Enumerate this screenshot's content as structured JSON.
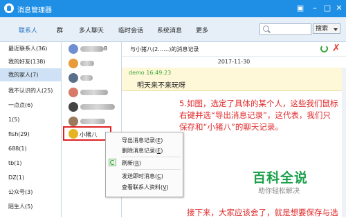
{
  "titlebar": {
    "title": "消息管理器"
  },
  "tabs": [
    "联系人",
    "群",
    "多人聊天",
    "临时会话",
    "系统消息",
    "更多"
  ],
  "search": {
    "placeholder": "",
    "button_label": "搜索"
  },
  "groups": [
    {
      "label": "最近联系人(36)"
    },
    {
      "label": "我的好友(138)"
    },
    {
      "label": "我的家人(7)"
    },
    {
      "label": "我不认识的人(25)"
    },
    {
      "label": "一点点(6)"
    },
    {
      "label": "1(5)"
    },
    {
      "label": "fish(29)"
    },
    {
      "label": "688(1)"
    },
    {
      "label": "tb(1)"
    },
    {
      "label": "DZ(1)"
    },
    {
      "label": "公众号(3)"
    },
    {
      "label": "陌生人(5)"
    }
  ],
  "contacts": [
    {
      "name": "8",
      "avatar_color": "#6f8fd0"
    },
    {
      "name": "",
      "avatar_color": "#e89b3a"
    },
    {
      "name": "",
      "avatar_color": "#5a6f8a"
    },
    {
      "name": "",
      "avatar_color": "#d77a6a"
    },
    {
      "name": "",
      "avatar_color": "#444444"
    },
    {
      "name": "",
      "avatar_color": "#9a7a5a"
    },
    {
      "name": "小猪八",
      "avatar_color": "#e6b422"
    }
  ],
  "chat": {
    "header": "与小猪八(2……)的消息记录",
    "date": "2017-11-30",
    "message_meta": "demo 16:49:23",
    "message_body": "明天来不来玩呀"
  },
  "menu": {
    "items": [
      {
        "label": "导出消息记录(",
        "key": "E",
        "tail": ")"
      },
      {
        "label": "删除消息记录(",
        "key": "E",
        "tail": ")"
      },
      {
        "label": "刷新(",
        "key": "R",
        "tail": ")"
      },
      {
        "label": "发送即时消息(",
        "key": "C",
        "tail": ")"
      },
      {
        "label": "查看联系人资料(",
        "key": "V",
        "tail": ")"
      }
    ]
  },
  "annotation": "5.如图，选定了具体的某个人，这些我们鼠标右键并选“导出消息记录”，这代表，我们只保存和“小猪八”的聊天记录。",
  "watermark": {
    "title": "百科全说",
    "subtitle": "助你轻松解决"
  },
  "bottom_text": "接下来，大家应该会了，就是想要保存与选"
}
